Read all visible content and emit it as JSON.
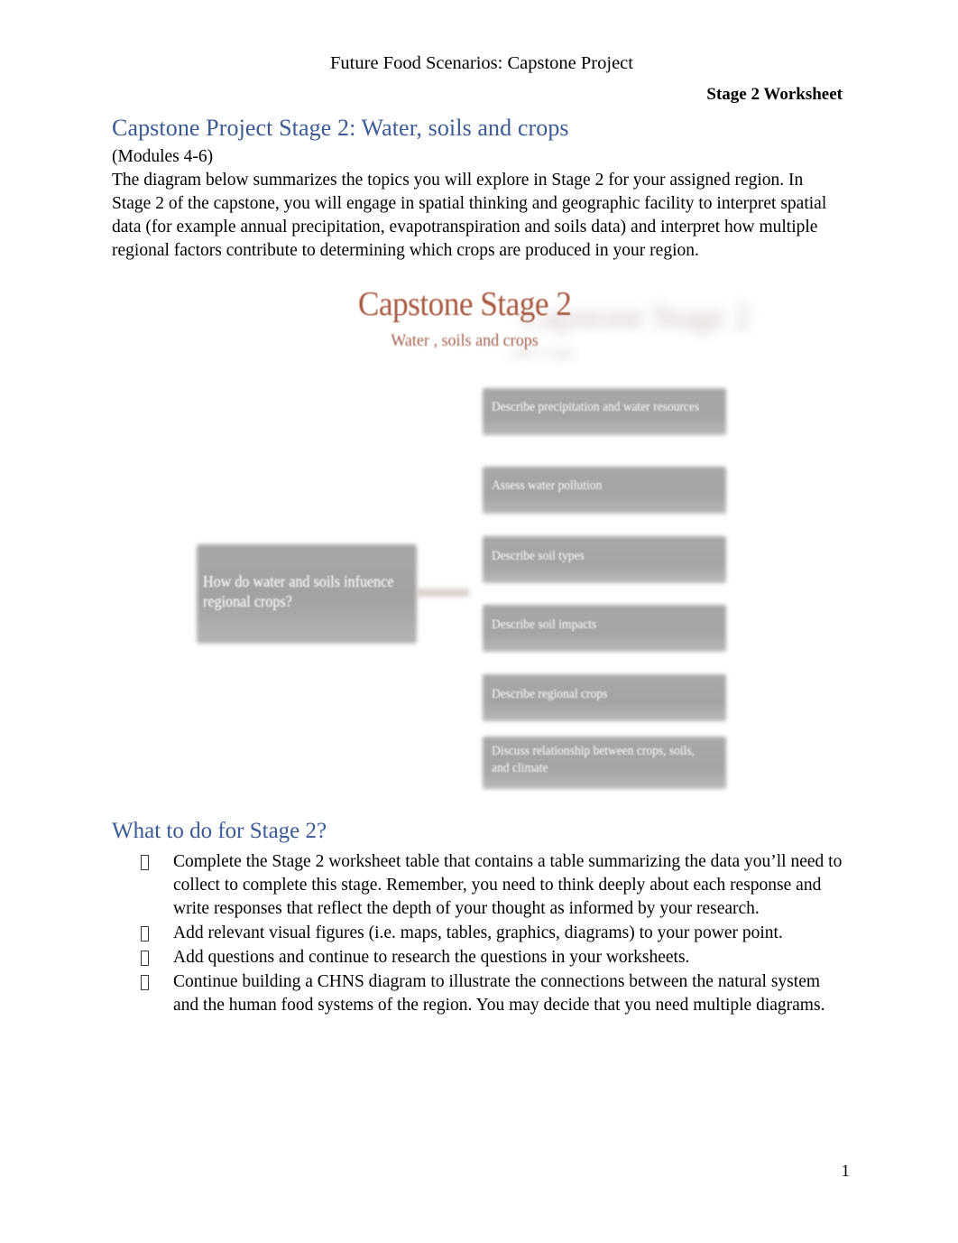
{
  "header": {
    "center_title": "Future Food Scenarios: Capstone Project",
    "right_title": "Stage 2 Worksheet"
  },
  "main": {
    "section_title": "Capstone Project Stage 2: Water, soils and crops",
    "modules_line": "(Modules 4-6)",
    "intro_paragraph": "The diagram below summarizes the topics you will explore in Stage 2 for your assigned region. In Stage 2 of the capstone, you will engage in spatial thinking  and  geographic facility to interpret spatial data (for example annual precipitation, evapotranspiration and soils data) and interpret how multiple regional factors contribute to determining which crops are produced in your region."
  },
  "diagram": {
    "title": "Capstone Stage 2",
    "subtitle": "Water    , soils    and crops",
    "ghost_title": "Capstone Stage 2",
    "ghost_subtitle": "and crops",
    "root_node": "How do water and soils infuence regional crops?",
    "branches": [
      "Describe precipitation and water resources",
      "Assess water pollution",
      "Describe soil types",
      "Describe soil impacts",
      "Describe regional crops",
      "Discuss relationship between crops, soils, and climate"
    ],
    "colors": {
      "title": "#a85a42",
      "box_fill": "#a6a6a6",
      "box_text": "#ffffff"
    }
  },
  "todo": {
    "title": "What to do for Stage 2?",
    "items": [
      "Complete the Stage 2 worksheet table that contains a table summarizing the data you’ll need to collect to complete this stage.    Remember, you need to think deeply about each response and write responses that reflect the depth of your thought as informed by your research.",
      "Add relevant visual figures (i.e. maps, tables, graphics, diagrams) to your power point.",
      "Add questions and continue to research the questions in your worksheets.",
      "Continue building a CHNS diagram to illustrate the connections between the natural system and the human food systems of the region. You may decide that you need multiple diagrams."
    ]
  },
  "footer": {
    "page_number": "1"
  },
  "theme": {
    "heading_color": "#3b5a96",
    "text_color": "#000000",
    "page_background": "#ffffff"
  }
}
